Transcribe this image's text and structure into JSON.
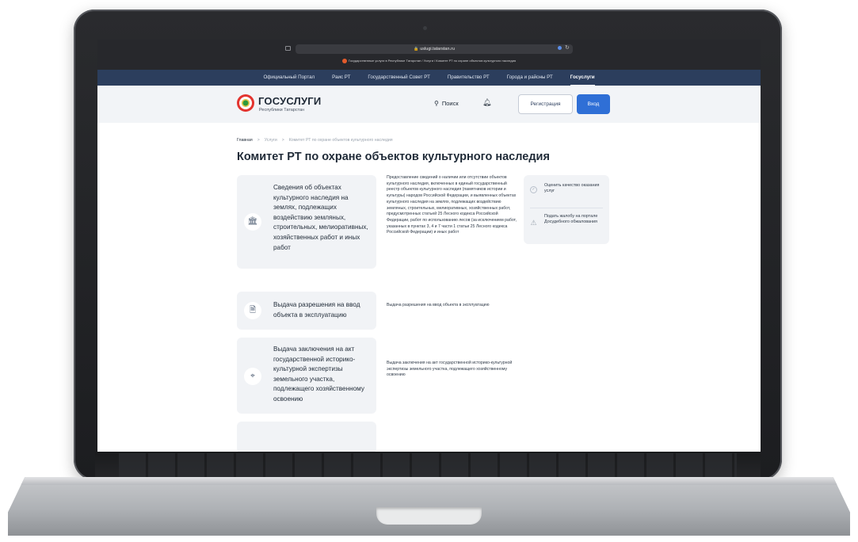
{
  "browser": {
    "url": "uslugi.tatarstan.ru",
    "tab_title": "Государственные услуги в Республике Татарстан / Услуги / Комитет РТ по охране объектов культурного наследия"
  },
  "top_nav": {
    "items": [
      "Официальный Портал",
      "Раис РТ",
      "Государственный Совет РТ",
      "Правительство РТ",
      "Города и районы РТ",
      "Госуслуги"
    ],
    "active": "Госуслуги"
  },
  "header": {
    "logo_title": "ГОСУСЛУГИ",
    "logo_subtitle": "Республики Татарстан",
    "search_label": "Поиск",
    "register_label": "Регистрация",
    "login_label": "Вход"
  },
  "breadcrumb": {
    "items": [
      "Главная",
      "Услуги",
      "Комитет РТ по охране объектов культурного наследия"
    ],
    "separator": ">"
  },
  "page_title": "Комитет РТ по охране объектов культурного наследия",
  "services": [
    {
      "title": "Сведения об объектах культурного наследия на землях, подлежащих воздействию земляных, строительных, мелиоративных, хозяйственных работ и иных работ",
      "icon": "bank-icon",
      "description": "Предоставление сведений о наличии или отсутствии объектов культурного наследия, включенных в единый государственный реестр объектов культурного наследия (памятников истории и культуры) народов Российской Федерации, и выявленных объектах культурного наследия на землях, подлежащих воздействию земляных, строительных, мелиоративных, хозяйственных работ, предусмотренных статьей 25 Лесного кодекса Российской Федерации, работ по использованию лесов (за исключением работ, указанных в пунктах 3, 4 и 7 части 1 статьи 25 Лесного кодекса Российской Федерации) и иных работ"
    },
    {
      "title": "Выдача разрешения на ввод объекта в эксплуатацию",
      "icon": "document-check-icon",
      "description": "Выдача разрешения на ввод объекта в эксплуатацию"
    },
    {
      "title": "Выдача заключения на акт государственной историко-культурной экспертизы земельного участка, подлежащего хозяйственному освоению",
      "icon": "land-plot-icon",
      "description": "Выдача заключения на акт государственной историко-культурной экспертизы земельного участка, подлежащего хозяйственному освоению"
    }
  ],
  "side_panel": {
    "rate_label": "Оценить качество оказания услуг",
    "complaint_label": "Подать жалобу на портале Досудебного обжалования"
  }
}
